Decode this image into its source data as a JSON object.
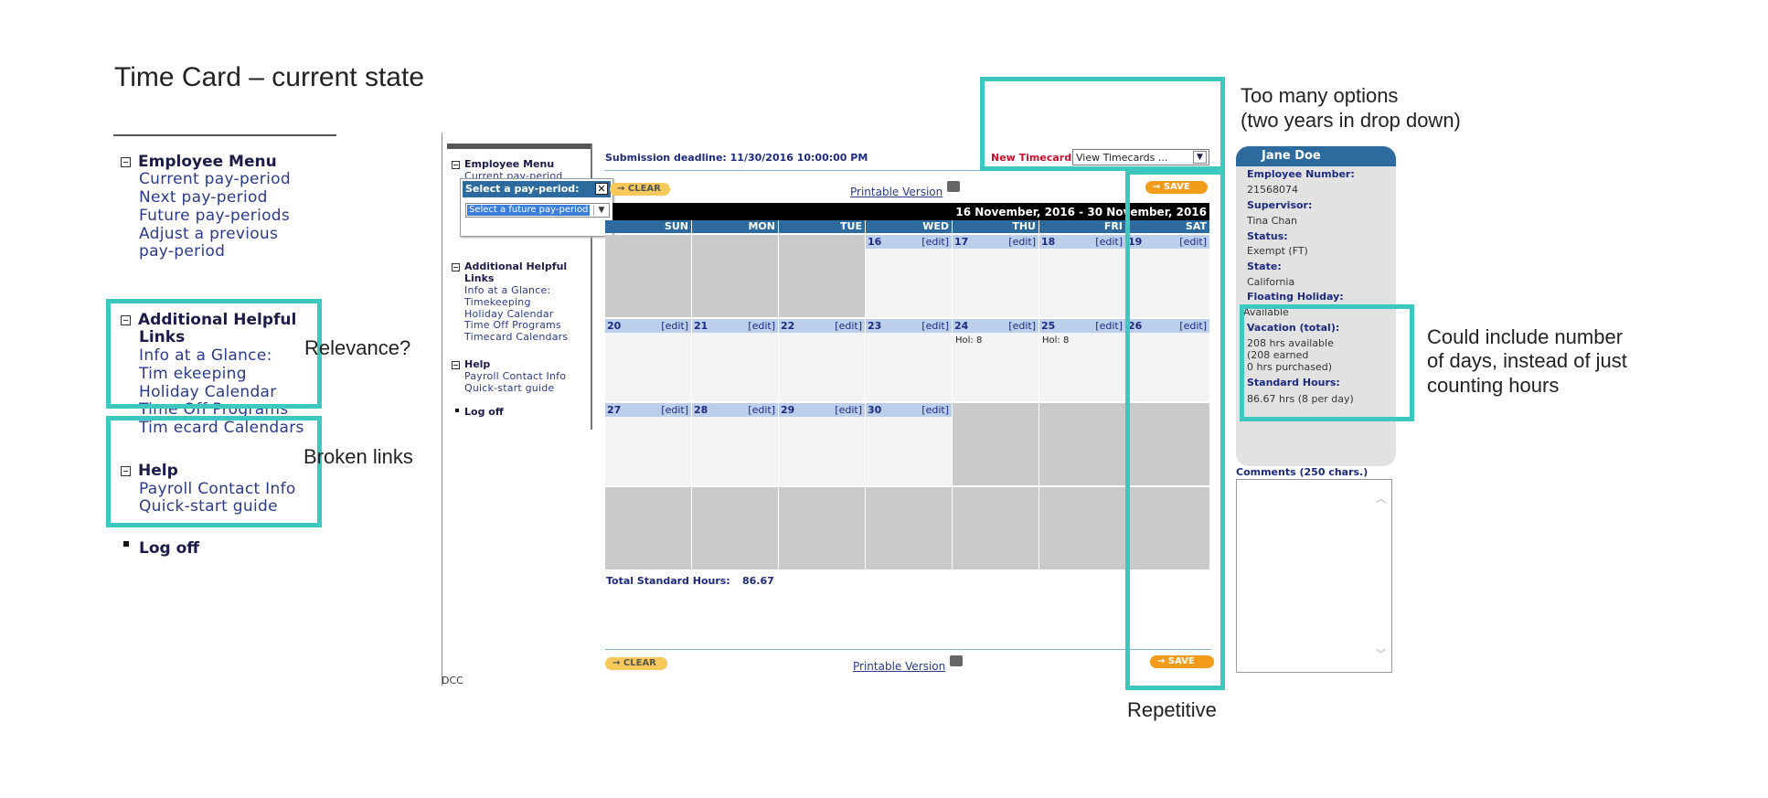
{
  "slide_title": "Time Card – current state",
  "annotations": {
    "too_many_line1": "Too many options",
    "too_many_line2": "(two years in drop down)",
    "relevance": "Relevance?",
    "broken_links": "Broken links",
    "could_line1": "Could include number",
    "could_line2": "of days, instead of just",
    "could_line3": "counting hours",
    "repetitive": "Repetitive"
  },
  "left_menu": {
    "employee_menu": "Employee Menu",
    "current": "Current pay-period",
    "next": "Next pay-period",
    "future": "Future pay-periods",
    "adjust1": "Adjust a previous",
    "adjust2": "pay-period",
    "additional1": "Additional Helpful",
    "additional2": "Links",
    "glance": "Info at a Glance:",
    "timekeeping": "Tim ekeeping",
    "holiday": "Holiday Calendar",
    "timeoff": "Time Off Programs",
    "timecard_cal": "Tim ecard Calendars",
    "help": "Help",
    "payroll": "Payroll Contact Info",
    "quickstart": "Quick-start guide",
    "logoff": "Log off"
  },
  "small_menu": {
    "employee_menu": "Employee Menu",
    "current": "Current pay-period",
    "additional1": "Additional Helpful",
    "additional2": "Links",
    "glance": "Info at a Glance:",
    "timekeeping": "Timekeeping",
    "holiday": "Holiday Calendar",
    "timeoff": "Time Off Programs",
    "timecard_cal": "Timecard Calendars",
    "help": "Help",
    "payroll": "Payroll Contact Info",
    "quickstart": "Quick-start guide",
    "logoff": "Log off",
    "footer": "DCC"
  },
  "popup": {
    "title": "Select a pay-period:",
    "select_value": "Select a future pay-period"
  },
  "timecard": {
    "deadline": "Submission deadline: 11/30/2016 10:00:00 PM",
    "new_timecard": "New Timecard",
    "view_select": "View Timecards ...",
    "clear": "CLEAR",
    "save": "SAVE",
    "printable": "Printable Version",
    "period": "16 November, 2016 - 30 November, 2016",
    "days": [
      "SUN",
      "MON",
      "TUE",
      "WED",
      "THU",
      "FRI",
      "SAT"
    ],
    "edit": "[edit]",
    "week1": [
      "",
      "",
      "",
      "16",
      "17",
      "18",
      "19"
    ],
    "week2": [
      "20",
      "21",
      "22",
      "23",
      "24",
      "25",
      "26"
    ],
    "week3": [
      "27",
      "28",
      "29",
      "30",
      "",
      "",
      ""
    ],
    "hol": "Hol: 8",
    "total_label": "Total Standard Hours:",
    "total_value": "86.67"
  },
  "info": {
    "name": "Jane Doe",
    "emp_no_label": "Employee Number:",
    "emp_no": "21568074",
    "supervisor_label": "Supervisor:",
    "supervisor": "Tina Chan",
    "status_label": "Status:",
    "status": "Exempt (FT)",
    "state_label": "State:",
    "state": "California",
    "floating_label": "Floating Holiday:",
    "floating": "Available",
    "vacation_label": "Vacation (total):",
    "vac1": "208 hrs available",
    "vac2": "(208 earned",
    "vac3": "0 hrs purchased)",
    "std_label": "Standard Hours:",
    "std": "86.67 hrs (8 per day)",
    "comments_label": "Comments (250 chars.)"
  },
  "accent_color": "#3cc8c0"
}
